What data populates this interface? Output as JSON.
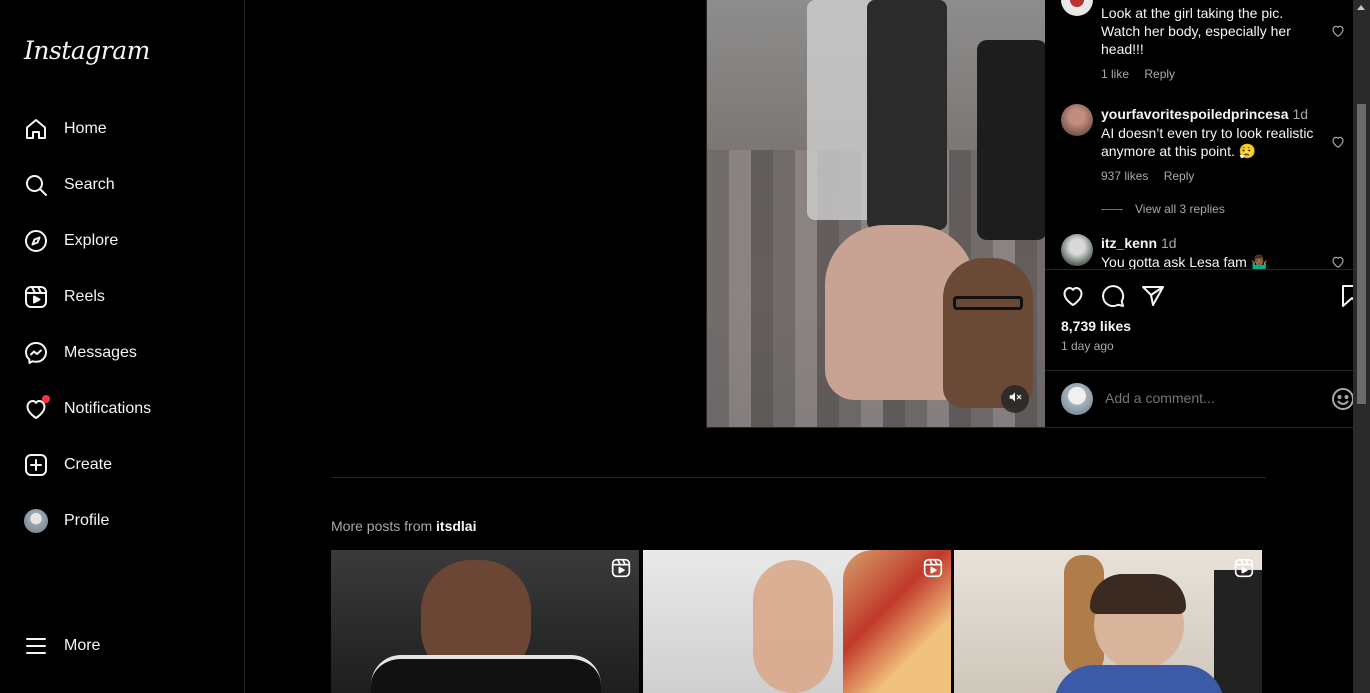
{
  "sidebar": {
    "logo": "Instagram",
    "items": [
      {
        "label": "Home",
        "icon": "home-icon"
      },
      {
        "label": "Search",
        "icon": "search-icon"
      },
      {
        "label": "Explore",
        "icon": "compass-icon"
      },
      {
        "label": "Reels",
        "icon": "reels-icon"
      },
      {
        "label": "Messages",
        "icon": "messenger-icon"
      },
      {
        "label": "Notifications",
        "icon": "heart-icon",
        "has_badge": true
      },
      {
        "label": "Create",
        "icon": "plus-square-icon"
      },
      {
        "label": "Profile",
        "icon": "avatar"
      }
    ],
    "more_label": "More"
  },
  "post": {
    "comments": [
      {
        "username": "",
        "time": "",
        "text": "Look at the girl taking the pic. Watch her body, especially her head!!!",
        "likes": "1 like",
        "reply": "Reply"
      },
      {
        "username": "yourfavoritespoiledprincesa",
        "time": "1d",
        "text": "AI doesn’t even try to look realistic anymore at this point. 😮‍💨",
        "likes": "937 likes",
        "reply": "Reply",
        "view_replies": "View all 3 replies"
      },
      {
        "username": "itz_kenn",
        "time": "1d",
        "text": "You gotta ask Lesa fam 🤷🏾‍♂️"
      }
    ],
    "likes_count": "8,739 likes",
    "posted_ago": "1 day ago",
    "add_comment_placeholder": "Add a comment..."
  },
  "more_posts": {
    "prefix": "More posts from ",
    "username": "itsdlai"
  },
  "colors": {
    "background": "#000000",
    "text": "#f5f5f5",
    "muted": "#a8a8a8",
    "border": "#262626",
    "notification_badge": "#ff3040"
  }
}
